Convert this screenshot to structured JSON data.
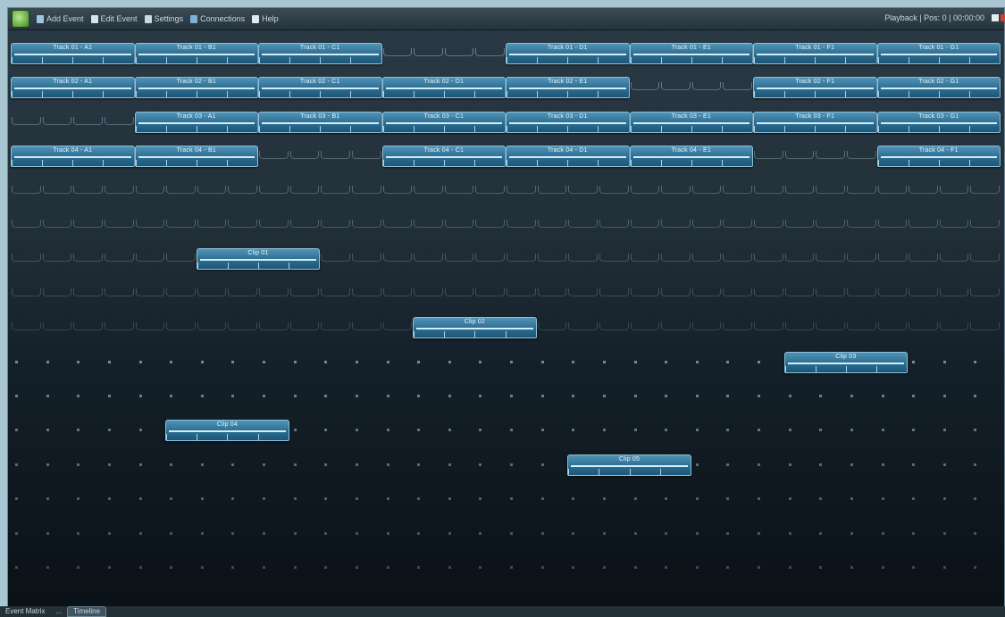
{
  "toolbar": {
    "items": [
      {
        "label": "Add Event",
        "icon": "calendar-add-icon"
      },
      {
        "label": "Edit Event",
        "icon": "edit-icon"
      },
      {
        "label": "Settings",
        "icon": "settings-icon"
      },
      {
        "label": "Connections",
        "icon": "link-icon"
      },
      {
        "label": "Help",
        "icon": "help-icon"
      }
    ],
    "status": "Playback | Pos: 0 | 00:00:00"
  },
  "colors": {
    "accent": "#2b6d91",
    "event_border": "#8fc1d9",
    "background_top": "#2a3a45",
    "background_bottom": "#0a1117"
  },
  "grid": {
    "rows": 16,
    "columns": 8
  },
  "events": [
    {
      "row": 0,
      "col_start": 0,
      "col_span": 1,
      "label": "Track 01 - A1"
    },
    {
      "row": 0,
      "col_start": 1,
      "col_span": 1,
      "label": "Track 01 - B1"
    },
    {
      "row": 0,
      "col_start": 2,
      "col_span": 1,
      "label": "Track 01 - C1"
    },
    {
      "row": 0,
      "col_start": 4,
      "col_span": 1,
      "label": "Track 01 - D1"
    },
    {
      "row": 0,
      "col_start": 5,
      "col_span": 1,
      "label": "Track 01 - E1"
    },
    {
      "row": 0,
      "col_start": 6,
      "col_span": 1,
      "label": "Track 01 - F1"
    },
    {
      "row": 0,
      "col_start": 7,
      "col_span": 1,
      "label": "Track 01 - G1"
    },
    {
      "row": 1,
      "col_start": 0,
      "col_span": 1,
      "label": "Track 02 - A1"
    },
    {
      "row": 1,
      "col_start": 1,
      "col_span": 1,
      "label": "Track 02 - B1"
    },
    {
      "row": 1,
      "col_start": 2,
      "col_span": 1,
      "label": "Track 02 - C1"
    },
    {
      "row": 1,
      "col_start": 3,
      "col_span": 1,
      "label": "Track 02 - D1"
    },
    {
      "row": 1,
      "col_start": 4,
      "col_span": 1,
      "label": "Track 02 - E1"
    },
    {
      "row": 1,
      "col_start": 6,
      "col_span": 1,
      "label": "Track 02 - F1"
    },
    {
      "row": 1,
      "col_start": 7,
      "col_span": 1,
      "label": "Track 02 - G1"
    },
    {
      "row": 2,
      "col_start": 1,
      "col_span": 1,
      "label": "Track 03 - A1"
    },
    {
      "row": 2,
      "col_start": 2,
      "col_span": 1,
      "label": "Track 03 - B1"
    },
    {
      "row": 2,
      "col_start": 3,
      "col_span": 1,
      "label": "Track 03 - C1"
    },
    {
      "row": 2,
      "col_start": 4,
      "col_span": 1,
      "label": "Track 03 - D1"
    },
    {
      "row": 2,
      "col_start": 5,
      "col_span": 1,
      "label": "Track 03 - E1"
    },
    {
      "row": 2,
      "col_start": 6,
      "col_span": 1,
      "label": "Track 03 - F1"
    },
    {
      "row": 2,
      "col_start": 7,
      "col_span": 1,
      "label": "Track 03 - G1"
    },
    {
      "row": 3,
      "col_start": 0,
      "col_span": 1,
      "label": "Track 04 - A1"
    },
    {
      "row": 3,
      "col_start": 1,
      "col_span": 1,
      "label": "Track 04 - B1"
    },
    {
      "row": 3,
      "col_start": 3,
      "col_span": 1,
      "label": "Track 04 - C1"
    },
    {
      "row": 3,
      "col_start": 4,
      "col_span": 1,
      "label": "Track 04 - D1"
    },
    {
      "row": 3,
      "col_start": 5,
      "col_span": 1,
      "label": "Track 04 - E1"
    },
    {
      "row": 3,
      "col_start": 7,
      "col_span": 1,
      "label": "Track 04 - F1"
    },
    {
      "row": 6,
      "col_start": 1.5,
      "col_span": 1,
      "label": "Clip 01"
    },
    {
      "row": 8,
      "col_start": 3.25,
      "col_span": 1,
      "label": "Clip 02"
    },
    {
      "row": 9,
      "col_start": 6.25,
      "col_span": 1,
      "label": "Clip 03"
    },
    {
      "row": 11,
      "col_start": 1.25,
      "col_span": 1,
      "label": "Clip 04"
    },
    {
      "row": 12,
      "col_start": 4.5,
      "col_span": 1,
      "label": "Clip 05"
    }
  ],
  "tabs": [
    {
      "label": "Event Matrix",
      "active": false
    },
    {
      "label": "...",
      "active": false
    },
    {
      "label": "Timeline",
      "active": true
    }
  ]
}
